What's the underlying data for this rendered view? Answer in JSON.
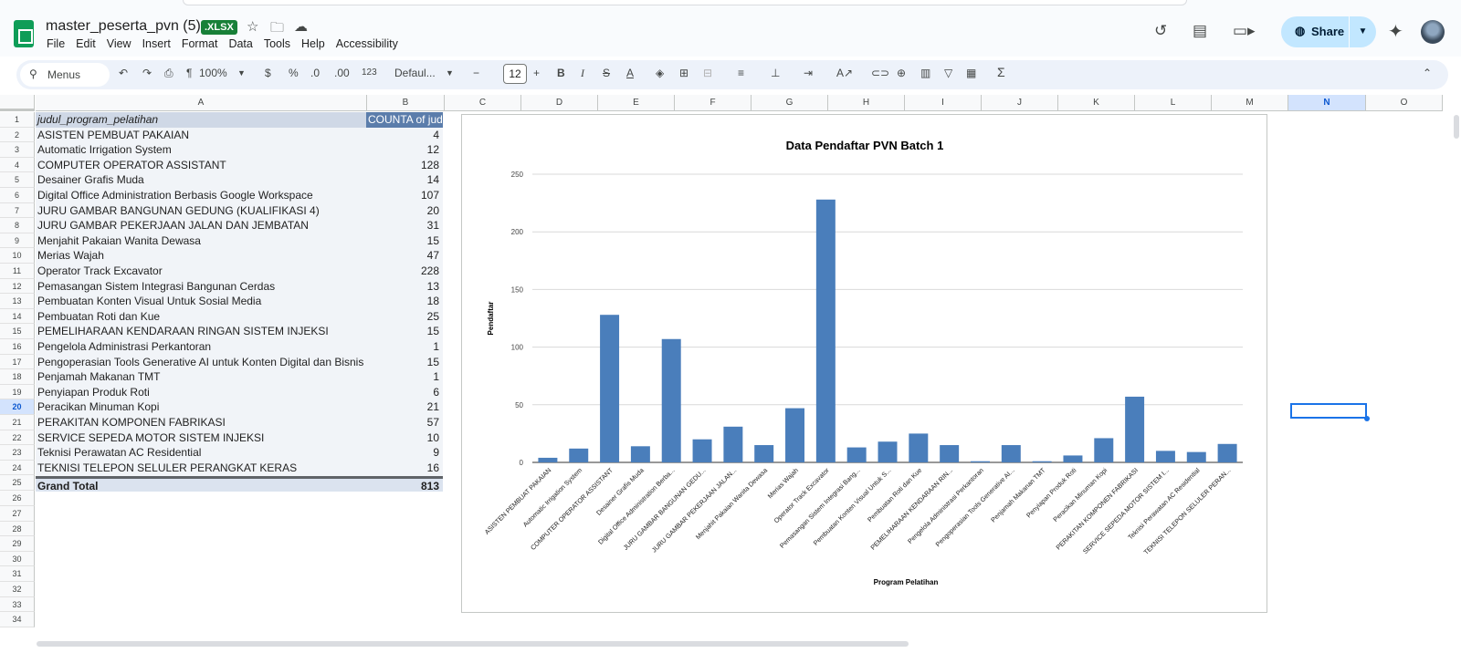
{
  "app": {
    "doc_title": "master_peserta_pvn (5)",
    "badge": ".XLSX",
    "menu": [
      "File",
      "Edit",
      "View",
      "Insert",
      "Format",
      "Data",
      "Tools",
      "Help",
      "Accessibility"
    ],
    "share_label": "Share"
  },
  "toolbar": {
    "search_label": "Menus",
    "zoom": "100%",
    "currency": "$",
    "percent": "%",
    "dec_dec": ".0",
    "dec_inc": ".00",
    "num_format": "123",
    "font_name": "Defaul...",
    "font_size": "12",
    "sum_symbol": "Σ"
  },
  "columns": [
    "A",
    "B",
    "C",
    "D",
    "E",
    "F",
    "G",
    "H",
    "I",
    "J",
    "K",
    "L",
    "M",
    "N",
    "O"
  ],
  "rows": [
    "1",
    "2",
    "3",
    "4",
    "5",
    "6",
    "7",
    "8",
    "9",
    "10",
    "11",
    "12",
    "13",
    "14",
    "15",
    "16",
    "17",
    "18",
    "19",
    "20",
    "21",
    "22",
    "23",
    "24",
    "25",
    "26",
    "27",
    "28",
    "29",
    "30",
    "31",
    "32",
    "33",
    "34"
  ],
  "pivot": {
    "header_a": "judul_program_pelatihan",
    "header_b": "COUNTA of jud",
    "items": [
      {
        "name": "ASISTEN PEMBUAT PAKAIAN",
        "count": "4"
      },
      {
        "name": "Automatic Irrigation System",
        "count": "12"
      },
      {
        "name": "COMPUTER OPERATOR ASSISTANT",
        "count": "128"
      },
      {
        "name": "Desainer Grafis Muda",
        "count": "14"
      },
      {
        "name": "Digital Office Administration Berbasis Google Workspace",
        "count": "107"
      },
      {
        "name": "JURU GAMBAR BANGUNAN GEDUNG (KUALIFIKASI 4)",
        "count": "20"
      },
      {
        "name": "JURU GAMBAR PEKERJAAN JALAN DAN JEMBATAN",
        "count": "31"
      },
      {
        "name": "Menjahit Pakaian Wanita Dewasa",
        "count": "15"
      },
      {
        "name": "Merias Wajah",
        "count": "47"
      },
      {
        "name": "Operator Track Excavator",
        "count": "228"
      },
      {
        "name": "Pemasangan Sistem Integrasi Bangunan Cerdas",
        "count": "13"
      },
      {
        "name": "Pembuatan Konten Visual Untuk Sosial Media",
        "count": "18"
      },
      {
        "name": "Pembuatan Roti dan Kue",
        "count": "25"
      },
      {
        "name": "PEMELIHARAAN KENDARAAN RINGAN SISTEM INJEKSI",
        "count": "15"
      },
      {
        "name": "Pengelola Administrasi Perkantoran",
        "count": "1"
      },
      {
        "name": "Pengoperasian Tools Generative AI untuk Konten Digital dan Bisnis",
        "count": "15"
      },
      {
        "name": "Penjamah Makanan TMT",
        "count": "1"
      },
      {
        "name": "Penyiapan Produk Roti",
        "count": "6"
      },
      {
        "name": "Peracikan Minuman Kopi",
        "count": "21"
      },
      {
        "name": "PERAKITAN KOMPONEN FABRIKASI",
        "count": "57"
      },
      {
        "name": "SERVICE SEPEDA MOTOR SISTEM INJEKSI",
        "count": "10"
      },
      {
        "name": "Teknisi Perawatan AC Residential",
        "count": "9"
      },
      {
        "name": "TEKNISI TELEPON SELULER PERANGKAT KERAS",
        "count": "16"
      }
    ],
    "total_label": "Grand Total",
    "total_value": "813"
  },
  "chart_data": {
    "type": "bar",
    "title": "Data Pendaftar PVN Batch 1",
    "xlabel": "Program Pelatihan",
    "ylabel": "Pendaftar",
    "ylim": [
      0,
      250
    ],
    "yticks": [
      0,
      50,
      100,
      150,
      200,
      250
    ],
    "grid": true,
    "bar_color": "#4a7ebb",
    "categories": [
      "ASISTEN PEMBUAT PAKAIAN",
      "Automatic Irrigation System",
      "COMPUTER OPERATOR ASSISTANT",
      "Desainer Grafis Muda",
      "Digital Office Administration Berba...",
      "JURU GAMBAR BANGUNAN GEDU...",
      "JURU GAMBAR PEKERJAAN JALAN...",
      "Menjahit Pakaian Wanita Dewasa",
      "Merias Wajah",
      "Operator Track Excavator",
      "Pemasangan Sistem Integrasi Bang...",
      "Pembuatan Konten Visual Untuk S...",
      "Pembuatan Roti dan Kue",
      "PEMELIHARAAN KENDARAAN RIN...",
      "Pengelola Administrasi Perkantoran",
      "Pengoperasian Tools Generative AI...",
      "Penjamah Makanan TMT",
      "Penyiapan Produk Roti",
      "Peracikan Minuman Kopi",
      "PERAKITAN KOMPONEN FABRIKASI",
      "SERVICE SEPEDA MOTOR SISTEM I...",
      "Teknisi Perawatan AC Residential",
      "TEKNISI TELEPON SELULER PERAN..."
    ],
    "values": [
      4,
      12,
      128,
      14,
      107,
      20,
      31,
      15,
      47,
      228,
      13,
      18,
      25,
      15,
      1,
      15,
      1,
      6,
      21,
      57,
      10,
      9,
      16
    ]
  }
}
